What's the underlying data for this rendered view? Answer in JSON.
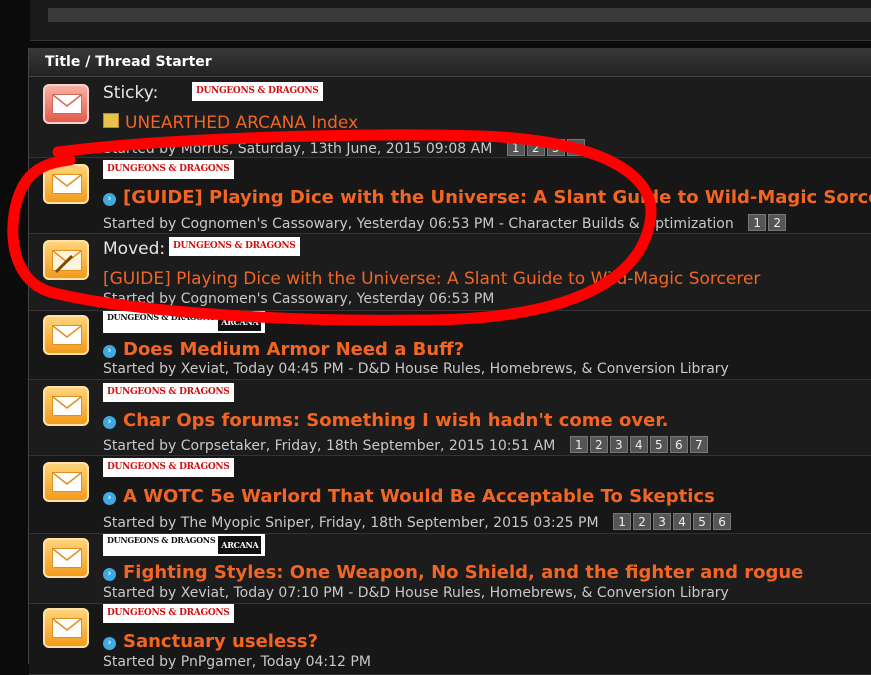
{
  "header": {
    "title": "Title / Thread Starter"
  },
  "badges": {
    "dd": "DUNGEONS & DRAGONS",
    "dd_a": "DUNGEONS & DRAGONS",
    "dd_b": "ARCANA"
  },
  "rows": [
    {
      "prefix": "Sticky:",
      "title": "UNEARTHED ARCANA Index",
      "meta": "Started by Morrus, Saturday, 13th June, 2015 09:08 AM",
      "pages": [
        "1",
        "2",
        "3",
        "4"
      ]
    },
    {
      "title": "[GUIDE] Playing Dice with the Universe: A Slant Guide to Wild-Magic Sorcerer",
      "meta": "Started by Cognomen's Cassowary, Yesterday 06:53 PM - Character Builds & Optimization",
      "pages": [
        "1",
        "2"
      ]
    },
    {
      "prefix": "Moved:",
      "title": "[GUIDE] Playing Dice with the Universe: A Slant Guide to Wild-Magic Sorcerer",
      "meta": "Started by Cognomen's Cassowary, Yesterday 06:53 PM"
    },
    {
      "title": "Does Medium Armor Need a Buff?",
      "meta": "Started by Xeviat, Today 04:45 PM - D&D House Rules, Homebrews, & Conversion Library"
    },
    {
      "title": "Char Ops forums: Something I wish hadn't come over.",
      "meta": "Started by Corpsetaker, Friday, 18th September, 2015 10:51 AM",
      "pages": [
        "1",
        "2",
        "3",
        "4",
        "5",
        "6",
        "7"
      ]
    },
    {
      "title": "A WOTC 5e Warlord That Would Be Acceptable To Skeptics",
      "meta": "Started by The Myopic Sniper, Friday, 18th September, 2015 03:25 PM",
      "pages": [
        "1",
        "2",
        "3",
        "4",
        "5",
        "6"
      ]
    },
    {
      "title": "Fighting Styles: One Weapon, No Shield, and the fighter and rogue",
      "meta": "Started by Xeviat, Today 07:10 PM - D&D House Rules, Homebrews, & Conversion Library"
    },
    {
      "title": "Sanctuary useless?",
      "meta": "Started by PnPgamer, Today 04:12 PM"
    }
  ],
  "colors": {
    "title": "#f26522",
    "annotation": "#ff0000",
    "arrow": "#3fa9e0"
  }
}
